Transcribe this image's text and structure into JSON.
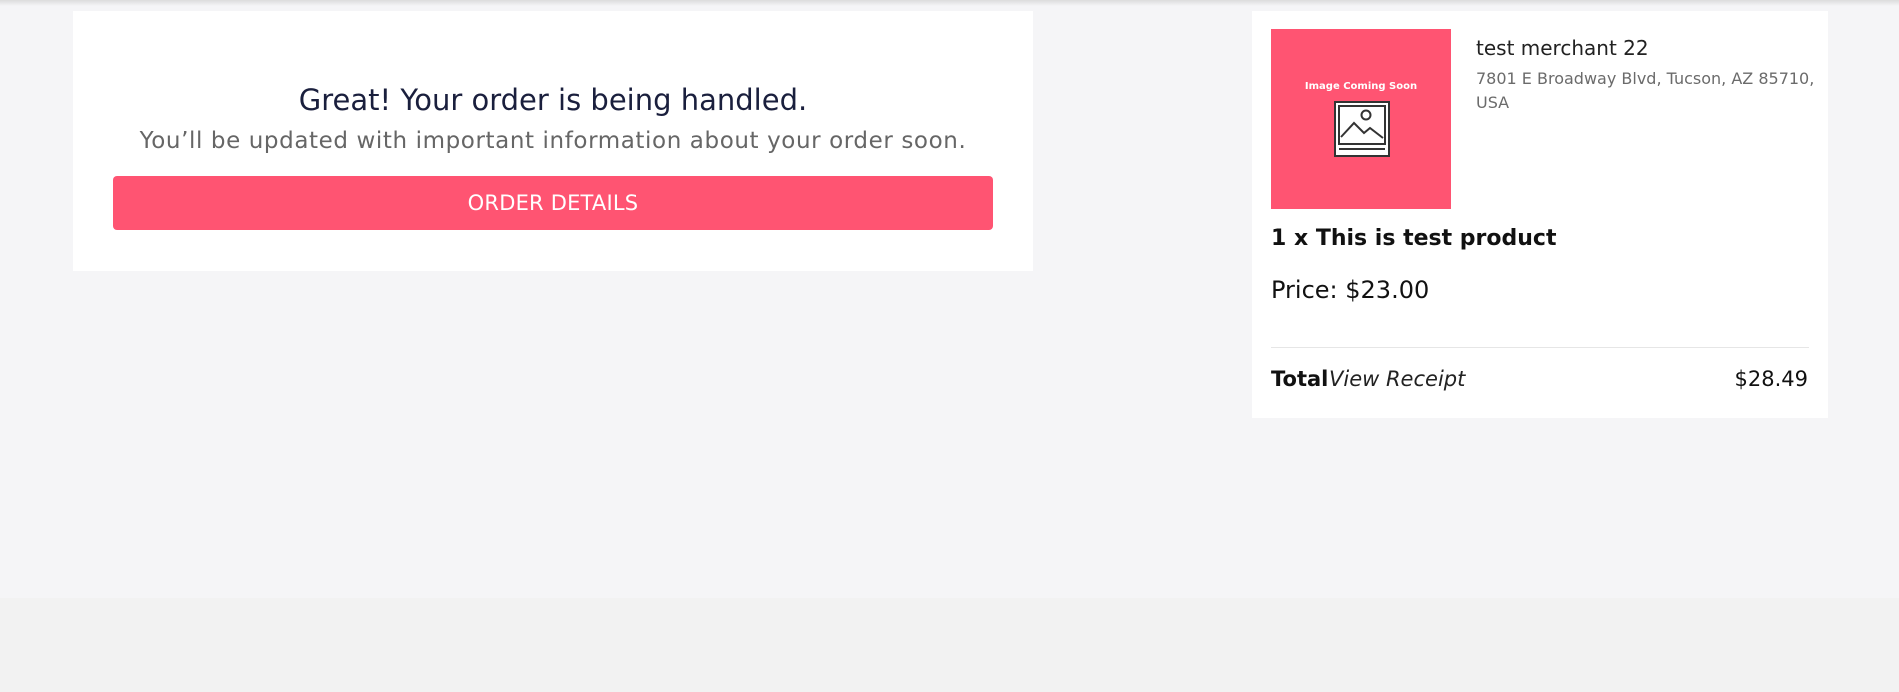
{
  "confirmation": {
    "title": "Great! Your order is being handled.",
    "subtitle": "You’ll be updated with important information about your order soon.",
    "button_label": "ORDER DETAILS"
  },
  "summary": {
    "image_text": "Image Coming Soon",
    "image_icon": "image-placeholder-icon",
    "merchant_name": "test merchant 22",
    "merchant_address": "7801 E Broadway Blvd, Tucson, AZ 85710, USA",
    "product_line": "1 x This is test product",
    "price_line": "Price: $23.00",
    "total_label": "Total",
    "view_receipt_label": "View Receipt",
    "total_amount": "$28.49"
  },
  "colors": {
    "accent": "#ff5472",
    "background": "#f5f5f7",
    "card": "#ffffff",
    "heading": "#1a1f3d"
  }
}
